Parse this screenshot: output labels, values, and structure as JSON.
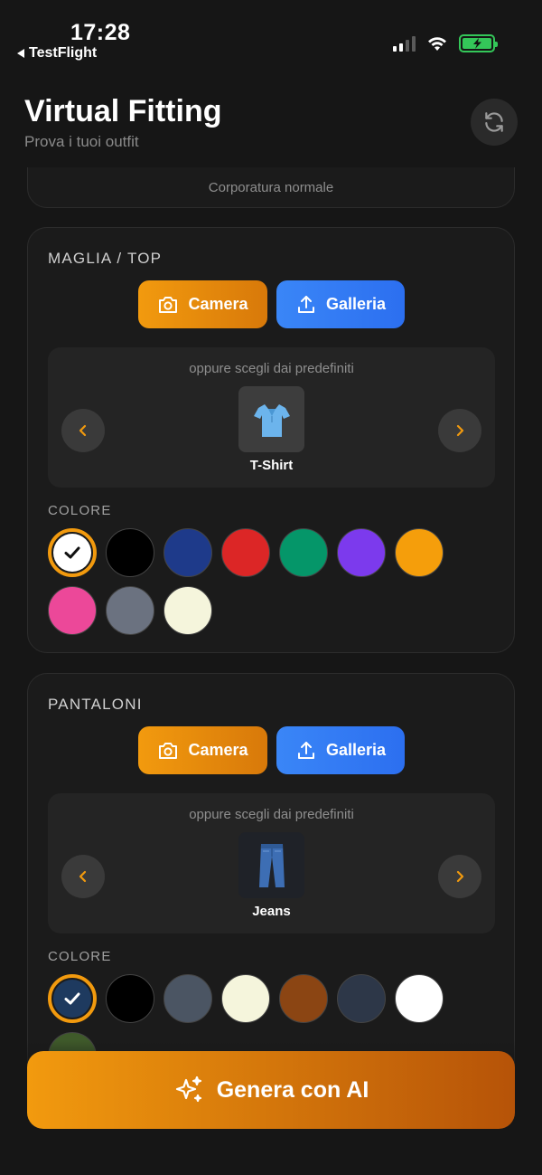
{
  "status_bar": {
    "time": "17:28",
    "back_app": "TestFlight",
    "battery_color": "#34c759"
  },
  "header": {
    "title": "Virtual Fitting",
    "subtitle": "Prova i tuoi outfit",
    "refresh_icon": "refresh-icon"
  },
  "body_card": {
    "text": "Corporatura normale"
  },
  "top_section": {
    "title": "MAGLIA / TOP",
    "camera_label": "Camera",
    "gallery_label": "Galleria",
    "preset_label": "oppure scegli dai predefiniti",
    "preset_name": "T-Shirt",
    "preset_icon": "tshirt-icon",
    "color_label": "COLORE",
    "colors": [
      "#ffffff",
      "#000000",
      "#1e3a8a",
      "#dc2626",
      "#059669",
      "#7c3aed",
      "#f59e0b",
      "#ec4899",
      "#6b7280",
      "#f5f5dc"
    ],
    "selected_color": "#ffffff"
  },
  "bottom_section": {
    "title": "PANTALONI",
    "camera_label": "Camera",
    "gallery_label": "Galleria",
    "preset_label": "oppure scegli dai predefiniti",
    "preset_name": "Jeans",
    "preset_icon": "jeans-icon",
    "color_label": "COLORE",
    "colors": [
      "#1e3a5f",
      "#000000",
      "#4b5563",
      "#f5f5dc",
      "#8b4513",
      "#2d3748",
      "#ffffff",
      "#3f5a2a"
    ],
    "selected_color": "#1e3a5f"
  },
  "cta": {
    "label": "Genera con AI",
    "icon": "sparkles-icon",
    "accent": "#f29a0e"
  }
}
